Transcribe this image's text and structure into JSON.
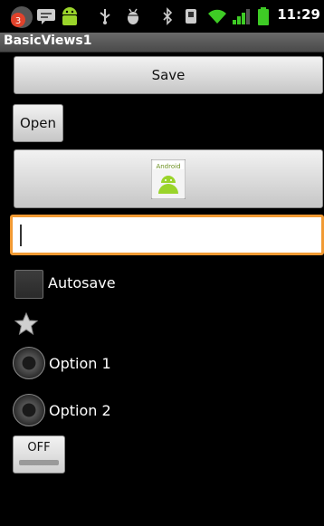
{
  "status_bar": {
    "time": "11:29",
    "icons": [
      "notification-badge-icon",
      "message-icon",
      "android-icon",
      "usb-icon",
      "debug-icon",
      "bluetooth-icon",
      "nfc-icon",
      "wifi-icon",
      "signal-icon",
      "battery-icon"
    ],
    "notification_count": "3"
  },
  "app": {
    "title": "BasicViews1"
  },
  "buttons": {
    "save_label": "Save",
    "open_label": "Open"
  },
  "image_button": {
    "image_label": "Android",
    "icon": "android-app-icon"
  },
  "text_field": {
    "value": ""
  },
  "checkbox": {
    "label": "Autosave",
    "checked": false
  },
  "star": {
    "icon": "star-icon",
    "filled": false
  },
  "radios": {
    "option1_label": "Option 1",
    "option2_label": "Option 2"
  },
  "toggle": {
    "label": "OFF",
    "on": false
  },
  "colors": {
    "focus_border": "#f19a33",
    "accent_green": "#9ad42a",
    "status_green": "#3ecb25"
  }
}
